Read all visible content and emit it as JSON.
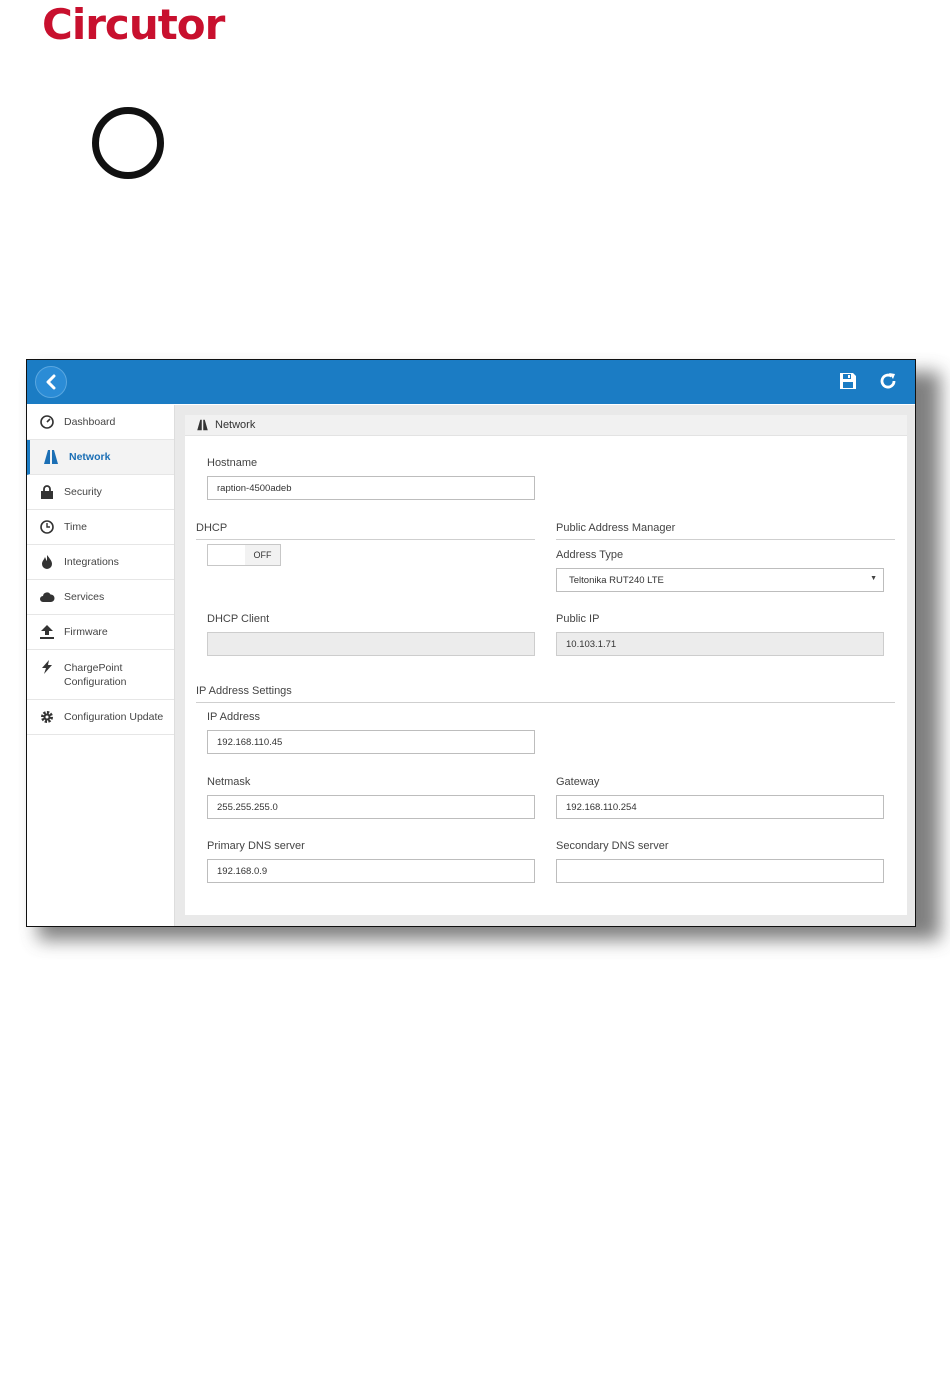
{
  "logo": {
    "text": "Circutor",
    "color": "#c8102e"
  },
  "topbar": {
    "color": "#1b7cc4",
    "back_icon": "chevron-left-icon",
    "save_icon": "floppy-save-icon",
    "refresh_icon": "refresh-icon"
  },
  "sidebar": {
    "items": [
      {
        "label": "Dashboard",
        "icon": "gauge-icon",
        "active": false
      },
      {
        "label": "Network",
        "icon": "road-icon",
        "active": true
      },
      {
        "label": "Security",
        "icon": "lock-icon",
        "active": false
      },
      {
        "label": "Time",
        "icon": "clock-icon",
        "active": false
      },
      {
        "label": "Integrations",
        "icon": "fire-icon",
        "active": false
      },
      {
        "label": "Services",
        "icon": "cloud-icon",
        "active": false
      },
      {
        "label": "Firmware",
        "icon": "upload-icon",
        "active": false
      },
      {
        "label": "ChargePoint Configuration",
        "icon": "bolt-icon",
        "active": false
      },
      {
        "label": "Configuration Update",
        "icon": "gear-icon",
        "active": false
      }
    ]
  },
  "panel": {
    "title": "Network"
  },
  "hostname": {
    "label": "Hostname",
    "value": "raption-4500adeb"
  },
  "dhcp": {
    "section": "DHCP",
    "toggle_state": "OFF",
    "client_label": "DHCP Client",
    "client_value": ""
  },
  "public": {
    "section": "Public Address Manager",
    "type_label": "Address Type",
    "type_value": "Teltonika RUT240 LTE",
    "ip_label": "Public IP",
    "ip_value": "10.103.1.71"
  },
  "ip_settings": {
    "section": "IP Address Settings",
    "ip_label": "IP Address",
    "ip_value": "192.168.110.45",
    "netmask_label": "Netmask",
    "netmask_value": "255.255.255.0",
    "gateway_label": "Gateway",
    "gateway_value": "192.168.110.254",
    "dns1_label": "Primary DNS server",
    "dns1_value": "192.168.0.9",
    "dns2_label": "Secondary DNS server",
    "dns2_value": ""
  }
}
